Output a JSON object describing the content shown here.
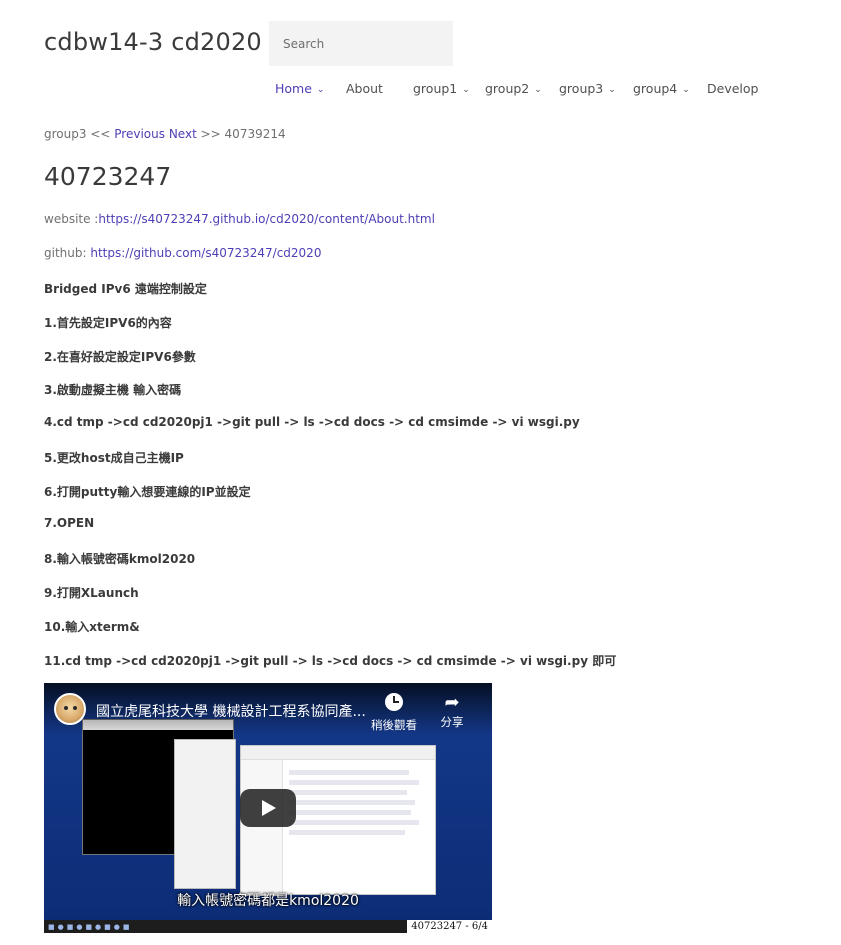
{
  "site": {
    "title": "cdbw14-3 cd2020"
  },
  "search": {
    "placeholder": "Search"
  },
  "nav": {
    "items": [
      {
        "label": "Home",
        "has_dropdown": true,
        "active": true
      },
      {
        "label": "About",
        "has_dropdown": false,
        "active": false
      },
      {
        "label": "group1",
        "has_dropdown": true,
        "active": false
      },
      {
        "label": "group2",
        "has_dropdown": true,
        "active": false
      },
      {
        "label": "group3",
        "has_dropdown": true,
        "active": false
      },
      {
        "label": "group4",
        "has_dropdown": true,
        "active": false
      },
      {
        "label": "Develop",
        "has_dropdown": false,
        "active": false
      }
    ],
    "dropdown_icon": "chevron-down-icon"
  },
  "breadcrumb": {
    "group": "group3",
    "prev_sep": "<<",
    "previous_label": "Previous",
    "next_label": "Next",
    "next_sep": ">>",
    "next_target": "40739214"
  },
  "page": {
    "title": "40723247",
    "website_label": "website :",
    "website_url": "https://s40723247.github.io/cd2020/content/About.html",
    "github_label": "github: ",
    "github_url": "https://github.com/s40723247/cd2020"
  },
  "steps": [
    "Bridged IPv6 遠端控制設定",
    "1.首先設定IPV6的內容",
    "2.在喜好設定設定IPV6參數",
    "3.啟動虛擬主機 輸入密碼",
    "4.cd tmp ->cd cd2020pj1 ->git pull -> ls ->cd docs -> cd cmsimde -> vi wsgi.py",
    "5.更改host成自己主機IP",
    "6.打開putty輸入想要連線的IP並設定",
    "7.OPEN",
    "8.輸入帳號密碼kmol2020",
    "9.打開XLaunch",
    "10.輸入xterm&",
    "11.cd tmp ->cd cd2020pj1 ->git pull -> ls ->cd docs -> cd cmsimde -> vi wsgi.py 即可"
  ],
  "video": {
    "title": "國立虎尾科技大學 機械設計工程系協同產...",
    "watch_later_label": "稍後觀看",
    "share_label": "分享",
    "subtitle": "輸入帳號密碼都是kmol2020",
    "page_counter": "40723247 - 6/4",
    "colors": {
      "background": "#0c2c75",
      "taskbar": "#1d1d1d"
    }
  },
  "colors": {
    "link": "#4d3fb5",
    "text": "#3a3a3a",
    "muted": "#707070"
  }
}
